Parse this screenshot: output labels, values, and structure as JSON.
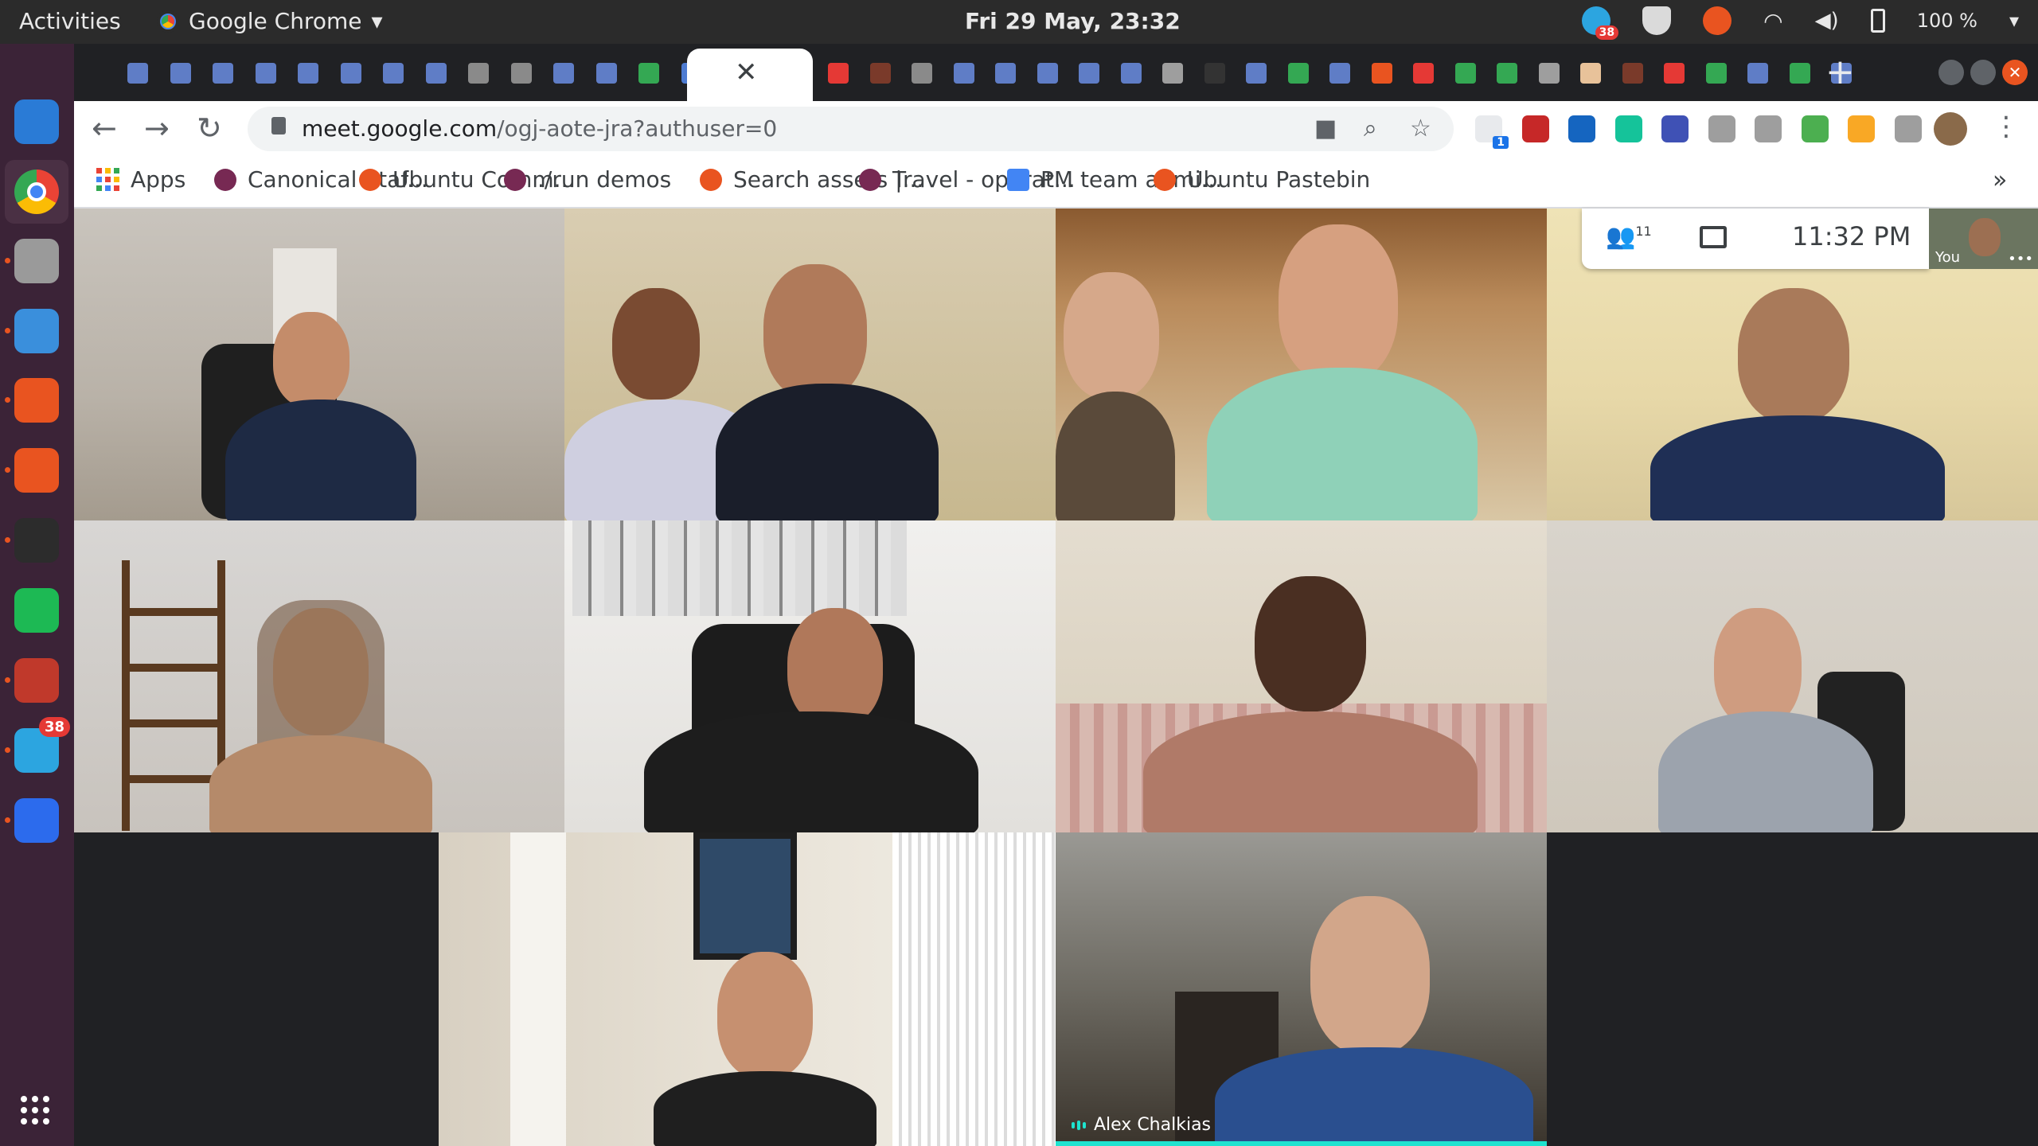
{
  "topbar": {
    "activities": "Activities",
    "app_name": "Google Chrome",
    "datetime": "Fri 29 May, 23:32",
    "notifications_badge": "38",
    "battery": "100 %"
  },
  "dock": {
    "items": [
      {
        "name": "thunderbird-icon",
        "color": "#2a7bd6"
      },
      {
        "name": "chrome-icon",
        "color": "#4285f4"
      },
      {
        "name": "files-icon",
        "color": "#9a9a9a"
      },
      {
        "name": "libreoffice-impress-icon",
        "color": "#3a8fdc"
      },
      {
        "name": "ubuntu-software-icon",
        "color": "#e95420"
      },
      {
        "name": "lifebuoy-icon",
        "color": "#e95420"
      },
      {
        "name": "terminal-icon",
        "color": "#2c2c2c"
      },
      {
        "name": "spotify-icon",
        "color": "#1db954"
      },
      {
        "name": "settings-tool-icon",
        "color": "#c0392b"
      },
      {
        "name": "telegram-icon",
        "color": "#2ca5e0"
      },
      {
        "name": "signal-icon",
        "color": "#2c6bed"
      }
    ],
    "telegram_badge": "38",
    "show_apps_label": ""
  },
  "chrome": {
    "close_tab_glyph": "✕",
    "new_tab_glyph": "+",
    "url_host": "meet.google.com",
    "url_path": "/ogj-aote-jra?authuser=0",
    "ext_badge": "1",
    "bookmarks_more": "»",
    "bookmarks": [
      {
        "label": "Apps",
        "color": "apps"
      },
      {
        "label": "Canonical Staf...",
        "color": "#772953"
      },
      {
        "label": "Ubuntu Comm...",
        "color": "#e95420"
      },
      {
        "label": "./run demos",
        "color": "#772953"
      },
      {
        "label": "Search assets |...",
        "color": "#e95420"
      },
      {
        "label": "Travel - operat...",
        "color": "#772953"
      },
      {
        "label": "PM team admi...",
        "color": "#4285f4"
      },
      {
        "label": "Ubuntu Pastebin",
        "color": "#e95420"
      }
    ]
  },
  "meet": {
    "participants_count": "11",
    "time": "11:32  PM",
    "self_label": "You",
    "self_menu": "•••",
    "active_speaker_name": "Alex Chalkias"
  },
  "colors": {
    "chrome_tabstrip": "#202124",
    "ubuntu_orange": "#e95420",
    "dock_purple": "#3b2337",
    "speaker_accent": "#1ee3cf"
  }
}
